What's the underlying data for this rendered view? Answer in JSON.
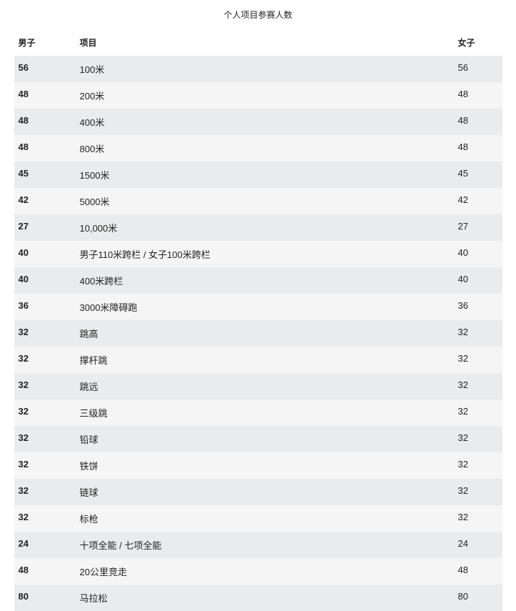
{
  "caption": "个人项目参赛人数",
  "headers": {
    "men": "男子",
    "event": "项目",
    "women": "女子"
  },
  "rows": [
    {
      "men": "56",
      "event": "100米",
      "women": "56"
    },
    {
      "men": "48",
      "event": "200米",
      "women": "48"
    },
    {
      "men": "48",
      "event": "400米",
      "women": "48"
    },
    {
      "men": "48",
      "event": "800米",
      "women": "48"
    },
    {
      "men": "45",
      "event": "1500米",
      "women": "45"
    },
    {
      "men": "42",
      "event": "5000米",
      "women": "42"
    },
    {
      "men": "27",
      "event": "10,000米",
      "women": "27"
    },
    {
      "men": "40",
      "event": "男子110米跨栏 / 女子100米跨栏",
      "women": "40"
    },
    {
      "men": "40",
      "event": "400米跨栏",
      "women": "40"
    },
    {
      "men": "36",
      "event": "3000米障碍跑",
      "women": "36"
    },
    {
      "men": "32",
      "event": "跳高",
      "women": "32"
    },
    {
      "men": "32",
      "event": "撑杆跳",
      "women": "32"
    },
    {
      "men": "32",
      "event": "跳远",
      "women": "32"
    },
    {
      "men": "32",
      "event": "三级跳",
      "women": "32"
    },
    {
      "men": "32",
      "event": "铅球",
      "women": "32"
    },
    {
      "men": "32",
      "event": "铁饼",
      "women": "32"
    },
    {
      "men": "32",
      "event": "链球",
      "women": "32"
    },
    {
      "men": "32",
      "event": "标枪",
      "women": "32"
    },
    {
      "men": "24",
      "event": "十项全能 / 七项全能",
      "women": "24"
    },
    {
      "men": "48",
      "event": "20公里竞走",
      "women": "48"
    },
    {
      "men": "80",
      "event": "马拉松",
      "women": "80"
    }
  ]
}
